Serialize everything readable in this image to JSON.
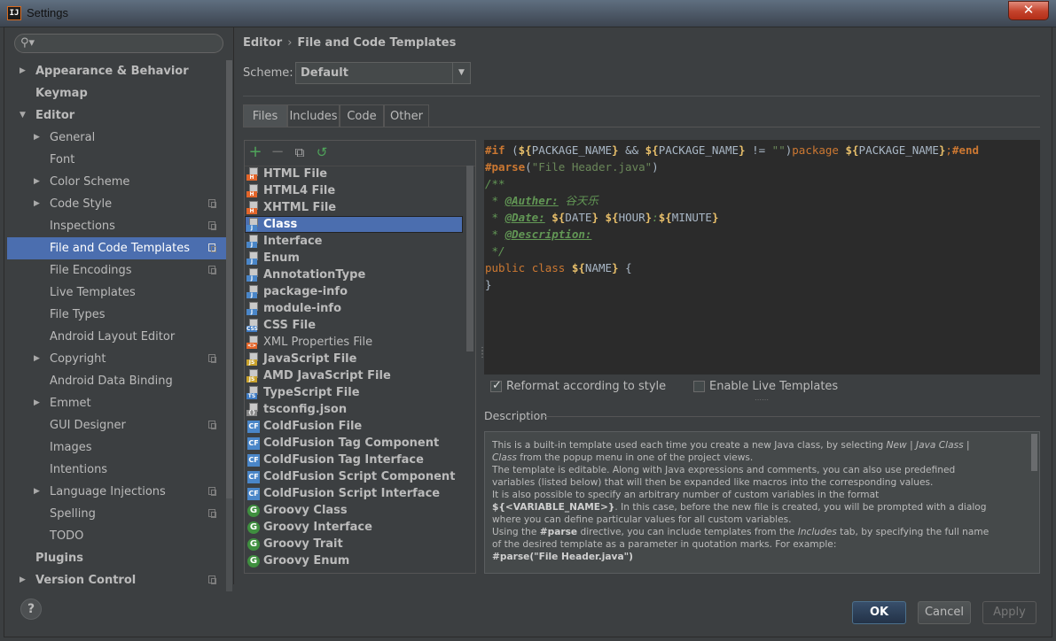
{
  "window": {
    "title": "Settings",
    "app_icon": "IJ",
    "close_glyph": "✕"
  },
  "search": {
    "placeholder": "",
    "icon": "search-icon"
  },
  "sidebar": {
    "items": [
      {
        "label": "Appearance & Behavior",
        "bold": true,
        "arrow": "▶",
        "level": 0,
        "selected": false,
        "project_icon": false
      },
      {
        "label": "Keymap",
        "bold": true,
        "arrow": "",
        "level": 0,
        "selected": false,
        "project_icon": false
      },
      {
        "label": "Editor",
        "bold": true,
        "arrow": "▼",
        "level": 0,
        "selected": false,
        "project_icon": false
      },
      {
        "label": "General",
        "bold": false,
        "arrow": "▶",
        "level": 1,
        "selected": false,
        "project_icon": false
      },
      {
        "label": "Font",
        "bold": false,
        "arrow": "",
        "level": 1,
        "selected": false,
        "project_icon": false
      },
      {
        "label": "Color Scheme",
        "bold": false,
        "arrow": "▶",
        "level": 1,
        "selected": false,
        "project_icon": false
      },
      {
        "label": "Code Style",
        "bold": false,
        "arrow": "▶",
        "level": 1,
        "selected": false,
        "project_icon": true
      },
      {
        "label": "Inspections",
        "bold": false,
        "arrow": "",
        "level": 1,
        "selected": false,
        "project_icon": true
      },
      {
        "label": "File and Code Templates",
        "bold": false,
        "arrow": "",
        "level": 1,
        "selected": true,
        "project_icon": true
      },
      {
        "label": "File Encodings",
        "bold": false,
        "arrow": "",
        "level": 1,
        "selected": false,
        "project_icon": true
      },
      {
        "label": "Live Templates",
        "bold": false,
        "arrow": "",
        "level": 1,
        "selected": false,
        "project_icon": false
      },
      {
        "label": "File Types",
        "bold": false,
        "arrow": "",
        "level": 1,
        "selected": false,
        "project_icon": false
      },
      {
        "label": "Android Layout Editor",
        "bold": false,
        "arrow": "",
        "level": 1,
        "selected": false,
        "project_icon": false
      },
      {
        "label": "Copyright",
        "bold": false,
        "arrow": "▶",
        "level": 1,
        "selected": false,
        "project_icon": true
      },
      {
        "label": "Android Data Binding",
        "bold": false,
        "arrow": "",
        "level": 1,
        "selected": false,
        "project_icon": false
      },
      {
        "label": "Emmet",
        "bold": false,
        "arrow": "▶",
        "level": 1,
        "selected": false,
        "project_icon": false
      },
      {
        "label": "GUI Designer",
        "bold": false,
        "arrow": "",
        "level": 1,
        "selected": false,
        "project_icon": true
      },
      {
        "label": "Images",
        "bold": false,
        "arrow": "",
        "level": 1,
        "selected": false,
        "project_icon": false
      },
      {
        "label": "Intentions",
        "bold": false,
        "arrow": "",
        "level": 1,
        "selected": false,
        "project_icon": false
      },
      {
        "label": "Language Injections",
        "bold": false,
        "arrow": "▶",
        "level": 1,
        "selected": false,
        "project_icon": true
      },
      {
        "label": "Spelling",
        "bold": false,
        "arrow": "",
        "level": 1,
        "selected": false,
        "project_icon": true
      },
      {
        "label": "TODO",
        "bold": false,
        "arrow": "",
        "level": 1,
        "selected": false,
        "project_icon": false
      },
      {
        "label": "Plugins",
        "bold": true,
        "arrow": "",
        "level": 0,
        "selected": false,
        "project_icon": false
      },
      {
        "label": "Version Control",
        "bold": true,
        "arrow": "▶",
        "level": 0,
        "selected": false,
        "project_icon": true
      }
    ]
  },
  "breadcrumb": {
    "parent": "Editor",
    "separator": "›",
    "current": "File and Code Templates"
  },
  "scheme": {
    "label": "Scheme:",
    "value": "Default",
    "arrow": "▼"
  },
  "tabs": [
    "Files",
    "Includes",
    "Code",
    "Other"
  ],
  "active_tab": "Files",
  "toolbar": {
    "add": "+",
    "remove": "−",
    "copy": "⧉",
    "reset": "↺"
  },
  "templates": [
    {
      "label": "HTML File",
      "bold": true,
      "icon": "html-file-icon",
      "tag": "H",
      "color": "#e2652a"
    },
    {
      "label": "HTML4 File",
      "bold": true,
      "icon": "html-file-icon",
      "tag": "H",
      "color": "#e2652a"
    },
    {
      "label": "XHTML File",
      "bold": true,
      "icon": "html-file-icon",
      "tag": "H",
      "color": "#e2652a"
    },
    {
      "label": "Class",
      "bold": true,
      "icon": "java-file-icon",
      "tag": "J",
      "color": "#4a86c8",
      "selected": true
    },
    {
      "label": "Interface",
      "bold": true,
      "icon": "java-file-icon",
      "tag": "J",
      "color": "#4a86c8"
    },
    {
      "label": "Enum",
      "bold": true,
      "icon": "java-file-icon",
      "tag": "J",
      "color": "#4a86c8"
    },
    {
      "label": "AnnotationType",
      "bold": true,
      "icon": "java-file-icon",
      "tag": "J",
      "color": "#4a86c8"
    },
    {
      "label": "package-info",
      "bold": true,
      "icon": "java-file-icon",
      "tag": "J",
      "color": "#4a86c8"
    },
    {
      "label": "module-info",
      "bold": true,
      "icon": "java-file-icon",
      "tag": "J",
      "color": "#4a86c8"
    },
    {
      "label": "CSS File",
      "bold": true,
      "icon": "css-file-icon",
      "tag": "CSS",
      "color": "#3e7ac2"
    },
    {
      "label": "XML Properties File",
      "bold": false,
      "icon": "xml-file-icon",
      "tag": "<>",
      "color": "#e2652a"
    },
    {
      "label": "JavaScript File",
      "bold": true,
      "icon": "js-file-icon",
      "tag": "JS",
      "color": "#c9a22c"
    },
    {
      "label": "AMD JavaScript File",
      "bold": true,
      "icon": "js-file-icon",
      "tag": "JS",
      "color": "#c9a22c"
    },
    {
      "label": "TypeScript File",
      "bold": true,
      "icon": "ts-file-icon",
      "tag": "TS",
      "color": "#3e7ac2"
    },
    {
      "label": "tsconfig.json",
      "bold": true,
      "icon": "json-file-icon",
      "tag": "{}",
      "color": "#888888"
    },
    {
      "label": "ColdFusion File",
      "bold": true,
      "icon": "coldfusion-icon",
      "tag": "CF",
      "color": "#4a86c8"
    },
    {
      "label": "ColdFusion Tag Component",
      "bold": true,
      "icon": "coldfusion-icon",
      "tag": "CF",
      "color": "#4a86c8"
    },
    {
      "label": "ColdFusion Tag Interface",
      "bold": true,
      "icon": "coldfusion-icon",
      "tag": "CF",
      "color": "#4a86c8"
    },
    {
      "label": "ColdFusion Script Component",
      "bold": true,
      "icon": "coldfusion-icon",
      "tag": "CF",
      "color": "#4a86c8"
    },
    {
      "label": "ColdFusion Script Interface",
      "bold": true,
      "icon": "coldfusion-icon",
      "tag": "CF",
      "color": "#4a86c8"
    },
    {
      "label": "Groovy Class",
      "bold": true,
      "icon": "groovy-icon",
      "tag": "G",
      "color": "#3f8f3f"
    },
    {
      "label": "Groovy Interface",
      "bold": true,
      "icon": "groovy-icon",
      "tag": "G",
      "color": "#3f8f3f"
    },
    {
      "label": "Groovy Trait",
      "bold": true,
      "icon": "groovy-icon",
      "tag": "G",
      "color": "#3f8f3f"
    },
    {
      "label": "Groovy Enum",
      "bold": true,
      "icon": "groovy-icon",
      "tag": "G",
      "color": "#3f8f3f"
    }
  ],
  "editor": {
    "l1": {
      "if": "#if",
      "p1": " (",
      "v1": "${",
      "v1n": "PACKAGE_NAME",
      "v1c": "}",
      "and": " && ",
      "v2": "${",
      "v2n": "PACKAGE_NAME",
      "v2c": "}",
      "neq": " != ",
      "q": "\"\"",
      "p2": ")",
      "pkg": "package",
      "sp": " ",
      "v3": "${",
      "v3n": "PACKAGE_NAME",
      "v3c": "}",
      "semi": ";",
      "end": "#end"
    },
    "l2": {
      "parse": "#parse",
      "p1": "(",
      "s": "\"File Header.java\"",
      "p2": ")"
    },
    "l3": "/**",
    "l4": {
      "star": " * ",
      "tag": "@Auther:",
      "txt": " 谷天乐"
    },
    "l5": {
      "star": " * ",
      "tag": "@Date:",
      "sp": " ",
      "v1": "${",
      "v1n": "DATE",
      "v1c": "}",
      "sp2": " ",
      "v2": "${",
      "v2n": "HOUR",
      "v2c": "}",
      "colon": ":",
      "v3": "${",
      "v3n": "MINUTE",
      "v3c": "}"
    },
    "l6": {
      "star": " * ",
      "tag": "@Description:"
    },
    "l7": " */",
    "l8": {
      "pub": "public",
      "sp": " ",
      "cls": "class",
      "sp2": " ",
      "v": "${",
      "vn": "NAME",
      "vc": "}",
      "rest": " {"
    },
    "l9": "}"
  },
  "options": {
    "reformat": {
      "label": "Reformat according to style",
      "checked": true
    },
    "live_templates": {
      "label": "Enable Live Templates",
      "checked": false
    }
  },
  "description": {
    "title": "Description",
    "lines": [
      {
        "a": "This is a built-in template used each time you create a new Java class, by selecting ",
        "i": "New | Java Class | ",
        "b": ""
      },
      {
        "a": "",
        "i": "Class",
        "b": " from the popup menu in one of the project views."
      },
      {
        "a": "The template is editable. Along with Java expressions and comments, you can also use predefined",
        "i": "",
        "b": ""
      },
      {
        "a": "variables (listed below) that will then be expanded like macros into the corresponding values.",
        "i": "",
        "b": ""
      },
      {
        "a": "It is also possible to specify an arbitrary number of custom variables in the format",
        "i": "",
        "b": ""
      },
      {
        "a": "",
        "bold": "${<VARIABLE_NAME>}",
        "b": ". In this case, before the new file is created, you will be prompted with a dialog"
      },
      {
        "a": "where you can define particular values for all custom variables.",
        "i": "",
        "b": ""
      },
      {
        "a": "Using the ",
        "bold": "#parse",
        "b": " directive, you can include templates from the ",
        "i": "Includes",
        "c": " tab, by specifying the full name"
      },
      {
        "a": "of the desired template as a parameter in quotation marks. For example:",
        "i": "",
        "b": ""
      },
      {
        "a": "",
        "bold": "#parse(\"File Header.java\")",
        "b": ""
      }
    ]
  },
  "buttons": {
    "help": "?",
    "ok": "OK",
    "cancel": "Cancel",
    "apply": "Apply"
  }
}
